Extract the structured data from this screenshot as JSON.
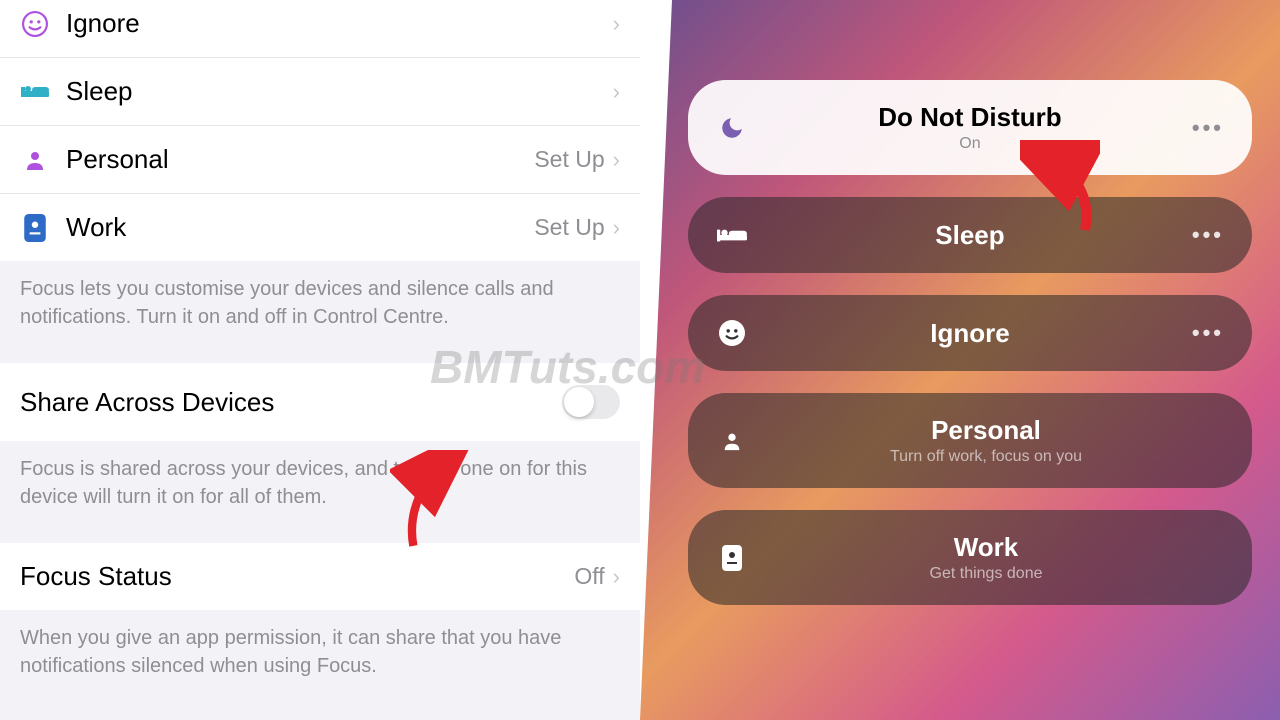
{
  "watermark": "BMTuts.com",
  "left": {
    "focusList": [
      {
        "icon": "smiley",
        "label": "Ignore",
        "action": "",
        "iconColor": "purple"
      },
      {
        "icon": "bed",
        "label": "Sleep",
        "action": "",
        "iconColor": "teal"
      },
      {
        "icon": "person",
        "label": "Personal",
        "action": "Set Up",
        "iconColor": "purple"
      },
      {
        "icon": "badge",
        "label": "Work",
        "action": "Set Up",
        "iconColor": "blue"
      }
    ],
    "focusFooter": "Focus lets you customise your devices and silence calls and notifications. Turn it on and off in Control Centre.",
    "shareAcross": {
      "label": "Share Across Devices"
    },
    "shareFooter": "Focus is shared across your devices, and turning one on for this device will turn it on for all of them.",
    "focusStatus": {
      "label": "Focus Status",
      "value": "Off"
    },
    "statusFooter": "When you give an app permission, it can share that you have notifications silenced when using Focus."
  },
  "right": {
    "items": [
      {
        "icon": "moon",
        "title": "Do Not Disturb",
        "sub": "On",
        "active": true
      },
      {
        "icon": "bed",
        "title": "Sleep",
        "sub": "",
        "active": false
      },
      {
        "icon": "smiley",
        "title": "Ignore",
        "sub": "",
        "active": false
      },
      {
        "icon": "person",
        "title": "Personal",
        "sub": "Turn off work, focus on you",
        "active": false
      },
      {
        "icon": "badge",
        "title": "Work",
        "sub": "Get things done",
        "active": false
      }
    ]
  }
}
